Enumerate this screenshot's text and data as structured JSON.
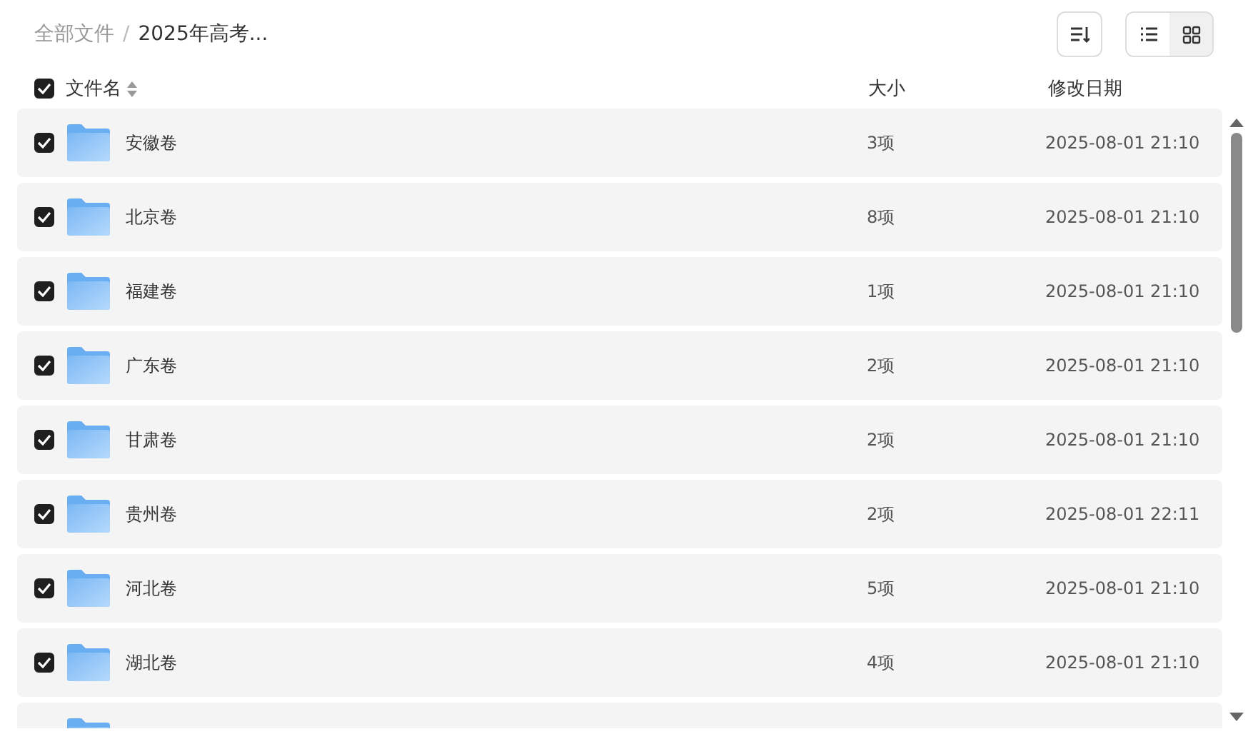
{
  "breadcrumb_separator": "/",
  "breadcrumb": [
    {
      "label": "全部文件",
      "current": false
    },
    {
      "label": "2025年高考...",
      "current": true
    }
  ],
  "view_toggle": [
    {
      "kind": "list",
      "selected": true
    },
    {
      "kind": "grid",
      "selected": false
    }
  ],
  "header": {
    "checked": true,
    "name": "文件名",
    "size": "大小",
    "date": "修改日期"
  },
  "rows": [
    {
      "checked": true,
      "name": "安徽卷",
      "size": "3项",
      "date": "2025-08-01 21:10"
    },
    {
      "checked": true,
      "name": "北京卷",
      "size": "8项",
      "date": "2025-08-01 21:10"
    },
    {
      "checked": true,
      "name": "福建卷",
      "size": "1项",
      "date": "2025-08-01 21:10"
    },
    {
      "checked": true,
      "name": "广东卷",
      "size": "2项",
      "date": "2025-08-01 21:10"
    },
    {
      "checked": true,
      "name": "甘肃卷",
      "size": "2项",
      "date": "2025-08-01 21:10"
    },
    {
      "checked": true,
      "name": "贵州卷",
      "size": "2项",
      "date": "2025-08-01 22:11"
    },
    {
      "checked": true,
      "name": "河北卷",
      "size": "5项",
      "date": "2025-08-01 21:10"
    },
    {
      "checked": true,
      "name": "湖北卷",
      "size": "4项",
      "date": "2025-08-01 21:10"
    },
    {
      "kind": "partial"
    }
  ]
}
